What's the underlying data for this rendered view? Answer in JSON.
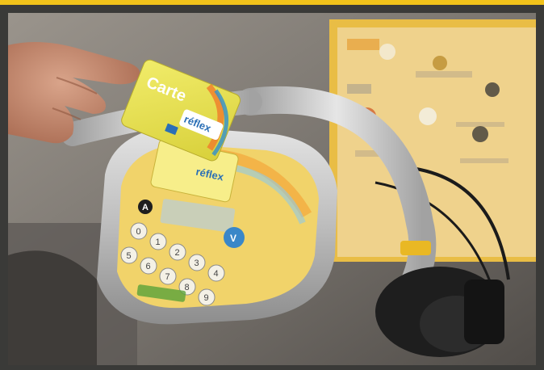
{
  "photo": {
    "card": {
      "brand": "Carte",
      "logo": "réflex"
    },
    "reader_card": {
      "logo": "réflex"
    },
    "keypad": {
      "keys": [
        "0",
        "1",
        "2",
        "3",
        "4",
        "5",
        "6",
        "7",
        "8",
        "9"
      ]
    },
    "colors": {
      "frame_accent": "#f2c21a",
      "card_yellow": "#e8e04a",
      "panel_yellow": "#f1d36a",
      "handlebar_silver": "#c9c9c9",
      "sign_panel": "#efc24b"
    }
  }
}
